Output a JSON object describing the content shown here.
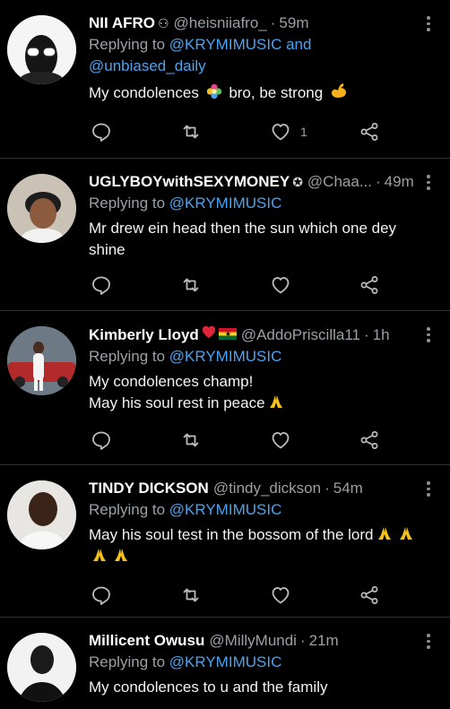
{
  "tweets": [
    {
      "name": "NII AFRO",
      "handle": "@heisniiafro_",
      "time": "59m",
      "replying_prefix": "Replying to ",
      "replying_to": "@KRYMIMUSIC and",
      "replying_to_2": "@unbiased_daily",
      "text_1": "My condolences",
      "text_2": "bro, be strong",
      "like_count": "1"
    },
    {
      "name": "UGLYBOYwithSEXYMONEY",
      "handle": "@Chaa...",
      "time": "49m",
      "replying_prefix": "Replying to ",
      "replying_to": "@KRYMIMUSIC",
      "text_1": "Mr drew ein head then the sun which one dey",
      "text_2": "shine"
    },
    {
      "name": "Kimberly Lloyd",
      "handle": "@AddoPriscilla11",
      "time": "1h",
      "replying_prefix": "Replying to ",
      "replying_to": "@KRYMIMUSIC",
      "text_1": "My condolences champ!",
      "text_2": "May his soul rest in peace"
    },
    {
      "name": "TINDY DICKSON",
      "handle": "@tindy_dickson",
      "time": "54m",
      "replying_prefix": "Replying to ",
      "replying_to": "@KRYMIMUSIC",
      "text_1": "May his soul test in the bossom of the lord"
    },
    {
      "name": "Millicent Owusu",
      "handle": "@MillyMundi",
      "time": "21m",
      "replying_prefix": "Replying to ",
      "replying_to": "@KRYMIMUSIC",
      "text_1": "My condolences to u and the family"
    }
  ],
  "separator": "·",
  "icons": {
    "reply": "reply-icon",
    "retweet": "retweet-icon",
    "like": "heart-icon",
    "share": "share-icon",
    "more": "more-options-icon"
  },
  "colors": {
    "background": "#000000",
    "mention": "#4ba3f0",
    "secondary_text": "#9aa0a6",
    "divider": "#2f3336",
    "emoji_hand": "#f5c21b"
  }
}
